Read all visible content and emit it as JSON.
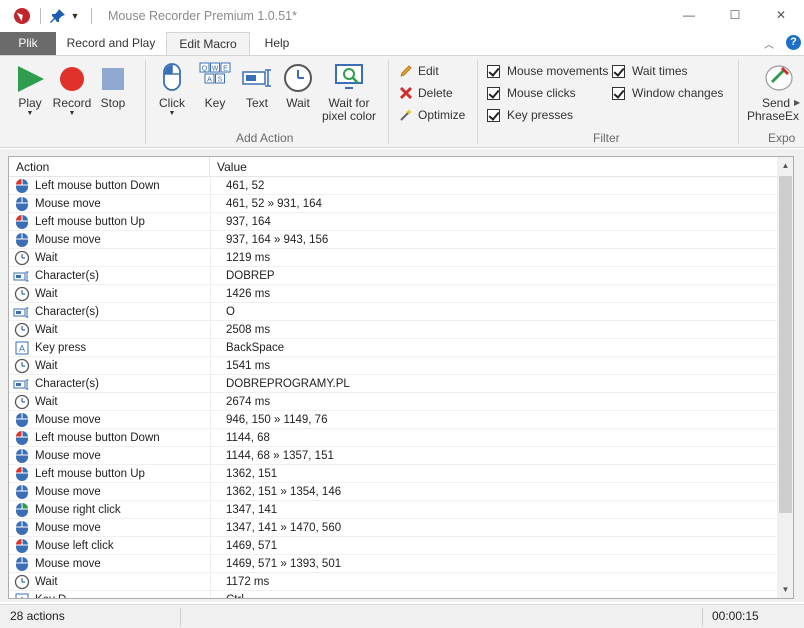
{
  "window": {
    "title": "Mouse Recorder Premium 1.0.51*",
    "minimize_glyph": "—",
    "maximize_glyph": "☐",
    "close_glyph": "✕"
  },
  "tabs": {
    "file": "Plik",
    "record_play": "Record and Play",
    "edit_macro": "Edit Macro",
    "help": "Help",
    "active": "Edit Macro"
  },
  "ribbon": {
    "play": "Play",
    "record": "Record",
    "stop": "Stop",
    "click": "Click",
    "key": "Key",
    "text": "Text",
    "wait": "Wait",
    "wait_pixel_line1": "Wait for",
    "wait_pixel_line2": "pixel color",
    "add_action_group": "Add Action",
    "edit": "Edit",
    "delete": "Delete",
    "optimize": "Optimize",
    "filter_group": "Filter",
    "filter": {
      "mouse_movements": {
        "label": "Mouse movements",
        "checked": true
      },
      "mouse_clicks": {
        "label": "Mouse clicks",
        "checked": true
      },
      "key_presses": {
        "label": "Key presses",
        "checked": true
      },
      "wait_times": {
        "label": "Wait times",
        "checked": true
      },
      "window_changes": {
        "label": "Window changes",
        "checked": true
      }
    },
    "send_line1": "Send",
    "send_line2": "PhraseEx",
    "export_group": "Expo"
  },
  "list": {
    "columns": [
      "Action",
      "Value"
    ],
    "rows": [
      {
        "icon": "mouse-left-down",
        "action": "Left mouse button Down",
        "value": "461, 52"
      },
      {
        "icon": "mouse-move",
        "action": "Mouse move",
        "value": "461, 52 » 931, 164"
      },
      {
        "icon": "mouse-left-down",
        "action": "Left mouse button Up",
        "value": "937, 164"
      },
      {
        "icon": "mouse-move",
        "action": "Mouse move",
        "value": "937, 164 » 943, 156"
      },
      {
        "icon": "wait",
        "action": "Wait",
        "value": "1219 ms"
      },
      {
        "icon": "text",
        "action": "Character(s)",
        "value": "DOBREP"
      },
      {
        "icon": "wait",
        "action": "Wait",
        "value": "1426 ms"
      },
      {
        "icon": "text",
        "action": "Character(s)",
        "value": "O"
      },
      {
        "icon": "wait",
        "action": "Wait",
        "value": "2508 ms"
      },
      {
        "icon": "key",
        "action": "Key press",
        "value": "BackSpace"
      },
      {
        "icon": "wait",
        "action": "Wait",
        "value": "1541 ms"
      },
      {
        "icon": "text",
        "action": "Character(s)",
        "value": "DOBREPROGRAMY.PL"
      },
      {
        "icon": "wait",
        "action": "Wait",
        "value": "2674 ms"
      },
      {
        "icon": "mouse-move",
        "action": "Mouse move",
        "value": "946, 150 » 1149, 76"
      },
      {
        "icon": "mouse-left-down",
        "action": "Left mouse button Down",
        "value": "1144, 68"
      },
      {
        "icon": "mouse-move",
        "action": "Mouse move",
        "value": "1144, 68 » 1357, 151"
      },
      {
        "icon": "mouse-left-down",
        "action": "Left mouse button Up",
        "value": "1362, 151"
      },
      {
        "icon": "mouse-move",
        "action": "Mouse move",
        "value": "1362, 151 » 1354, 146"
      },
      {
        "icon": "mouse-right",
        "action": "Mouse right click",
        "value": "1347, 141"
      },
      {
        "icon": "mouse-move",
        "action": "Mouse move",
        "value": "1347, 141 » 1470, 560"
      },
      {
        "icon": "mouse-left-down",
        "action": "Mouse left click",
        "value": "1469, 571"
      },
      {
        "icon": "mouse-move",
        "action": "Mouse move",
        "value": "1469, 571 » 1393, 501"
      },
      {
        "icon": "wait",
        "action": "Wait",
        "value": "1172 ms"
      },
      {
        "icon": "key",
        "action": "Key D",
        "value": "Ctrl"
      }
    ]
  },
  "status": {
    "count": "28 actions",
    "elapsed": "00:00:15"
  },
  "colors": {
    "record_red": "#e0322b",
    "play_green": "#2e9e4e",
    "stop_blue": "#7b9fd1",
    "mouse_blue": "#3a6fb5",
    "file_tab": "#6b6b6b"
  }
}
